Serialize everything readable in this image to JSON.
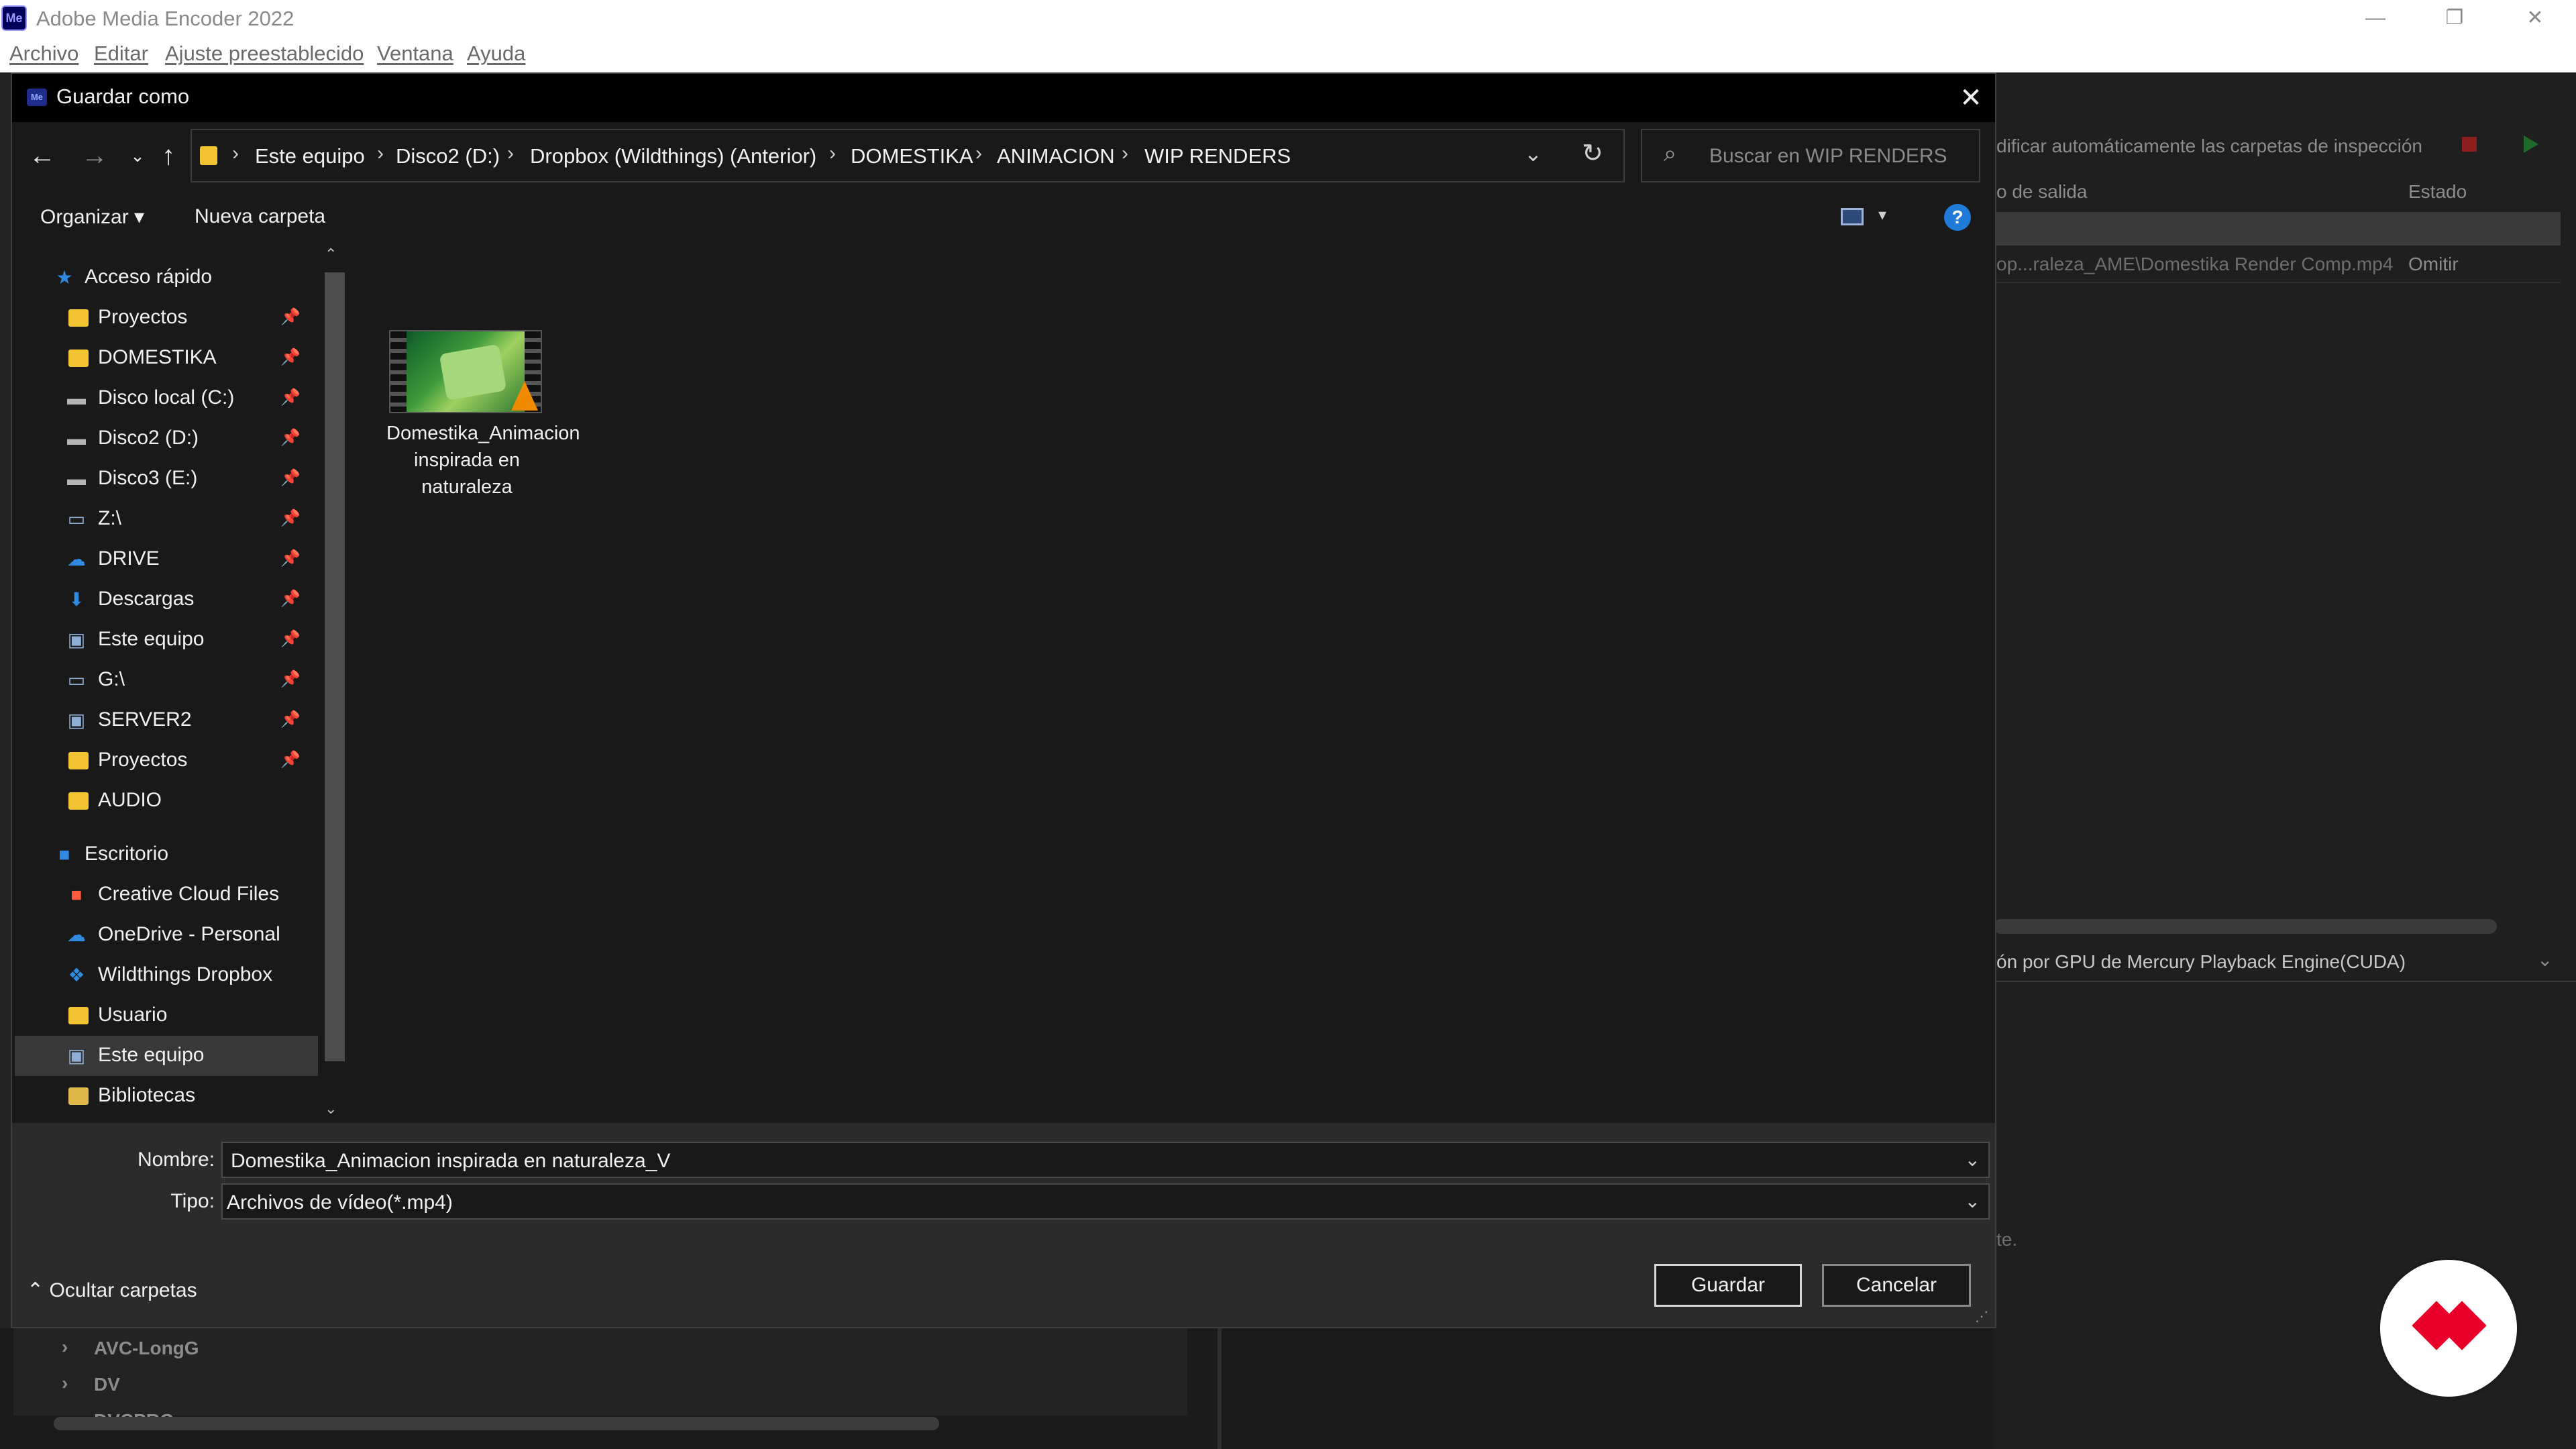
{
  "app": {
    "title": "Adobe Media Encoder 2022",
    "icon_text": "Me",
    "window_controls": [
      "minimize-icon",
      "restore-icon",
      "close-icon"
    ]
  },
  "menubar": [
    "Archivo",
    "Editar",
    "Ajuste preestablecido",
    "Ventana",
    "Ayuda"
  ],
  "background": {
    "watch_folders_text": "dificar automáticamente las carpetas de inspección",
    "col_output": "o de salida",
    "col_status": "Estado",
    "row_output": "op...raleza_AME\\Domestika Render Comp.mp4",
    "row_status": "Omitir",
    "renderer": "ón por GPU de Mercury Playback Engine(CUDA)",
    "fragment": "te.",
    "presets": [
      "AVC-LongG",
      "DV",
      "DVCPRO"
    ]
  },
  "dialog": {
    "title": "Guardar como",
    "breadcrumbs": [
      "Este equipo",
      "Disco2 (D:)",
      "Dropbox (Wildthings) (Anterior)",
      "DOMESTIKA",
      "ANIMACION",
      "WIP RENDERS"
    ],
    "search_placeholder": "Buscar en WIP RENDERS",
    "toolbar": {
      "organize": "Organizar ▾",
      "new_folder": "Nueva carpeta"
    },
    "nav": {
      "quick_access": "Acceso rápido",
      "quick_items": [
        {
          "label": "Proyectos",
          "icon": "folder-icon"
        },
        {
          "label": "DOMESTIKA",
          "icon": "folder-icon"
        },
        {
          "label": "Disco local (C:)",
          "icon": "drive-icon"
        },
        {
          "label": "Disco2 (D:)",
          "icon": "drive-icon"
        },
        {
          "label": "Disco3 (E:)",
          "icon": "drive-icon"
        },
        {
          "label": "Z:\\",
          "icon": "network-drive-icon"
        },
        {
          "label": "DRIVE",
          "icon": "cloud-icon"
        },
        {
          "label": "Descargas",
          "icon": "download-icon"
        },
        {
          "label": "Este equipo",
          "icon": "computer-icon"
        },
        {
          "label": "G:\\",
          "icon": "network-drive-icon"
        },
        {
          "label": "SERVER2",
          "icon": "computer-icon"
        },
        {
          "label": "Proyectos",
          "icon": "folder-icon"
        },
        {
          "label": "AUDIO",
          "icon": "folder-icon"
        }
      ],
      "desktop": "Escritorio",
      "desktop_items": [
        {
          "label": "Creative Cloud Files",
          "icon": "creative-cloud-icon"
        },
        {
          "label": "OneDrive - Personal",
          "icon": "onedrive-icon"
        },
        {
          "label": "Wildthings Dropbox",
          "icon": "dropbox-icon"
        },
        {
          "label": "Usuario",
          "icon": "user-folder-icon"
        },
        {
          "label": "Este equipo",
          "icon": "computer-icon"
        },
        {
          "label": "Bibliotecas",
          "icon": "libraries-icon"
        }
      ]
    },
    "file": {
      "name": "Domestika_Animacion inspirada en naturaleza"
    },
    "filename_label": "Nombre:",
    "filename_value": "Domestika_Animacion inspirada en naturaleza_V",
    "type_label": "Tipo:",
    "type_value": "Archivos de vídeo(*.mp4)",
    "hide_folders": "Ocultar carpetas",
    "save_button": "Guardar",
    "cancel_button": "Cancelar"
  }
}
